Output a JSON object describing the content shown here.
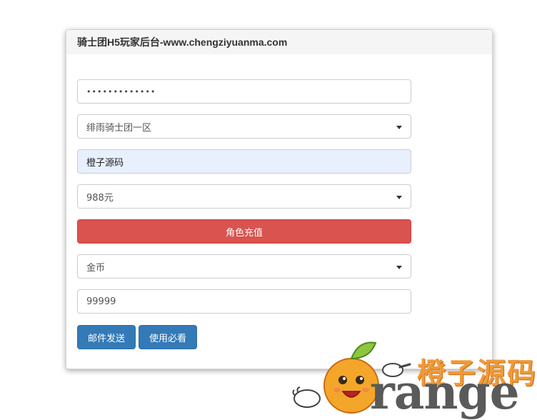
{
  "panel": {
    "title": "骑士团H5玩家后台-www.chengziyuanma.com"
  },
  "form": {
    "password_value": "•••••••••••••",
    "server_select": "绯雨骑士团一区",
    "role_name_value": "橙子源码",
    "amount_select": "988元",
    "recharge_button": "角色充值",
    "item_select": "金币",
    "quantity_value": "99999",
    "send_mail_button": "邮件发送",
    "instructions_button": "使用必看"
  },
  "watermark": {
    "chinese_text": "橙子源码",
    "english_text": "range"
  },
  "colors": {
    "danger": "#d9534f",
    "primary": "#337ab7",
    "autofill": "#e8f0fe",
    "watermark_orange": "#ef9a3a"
  }
}
